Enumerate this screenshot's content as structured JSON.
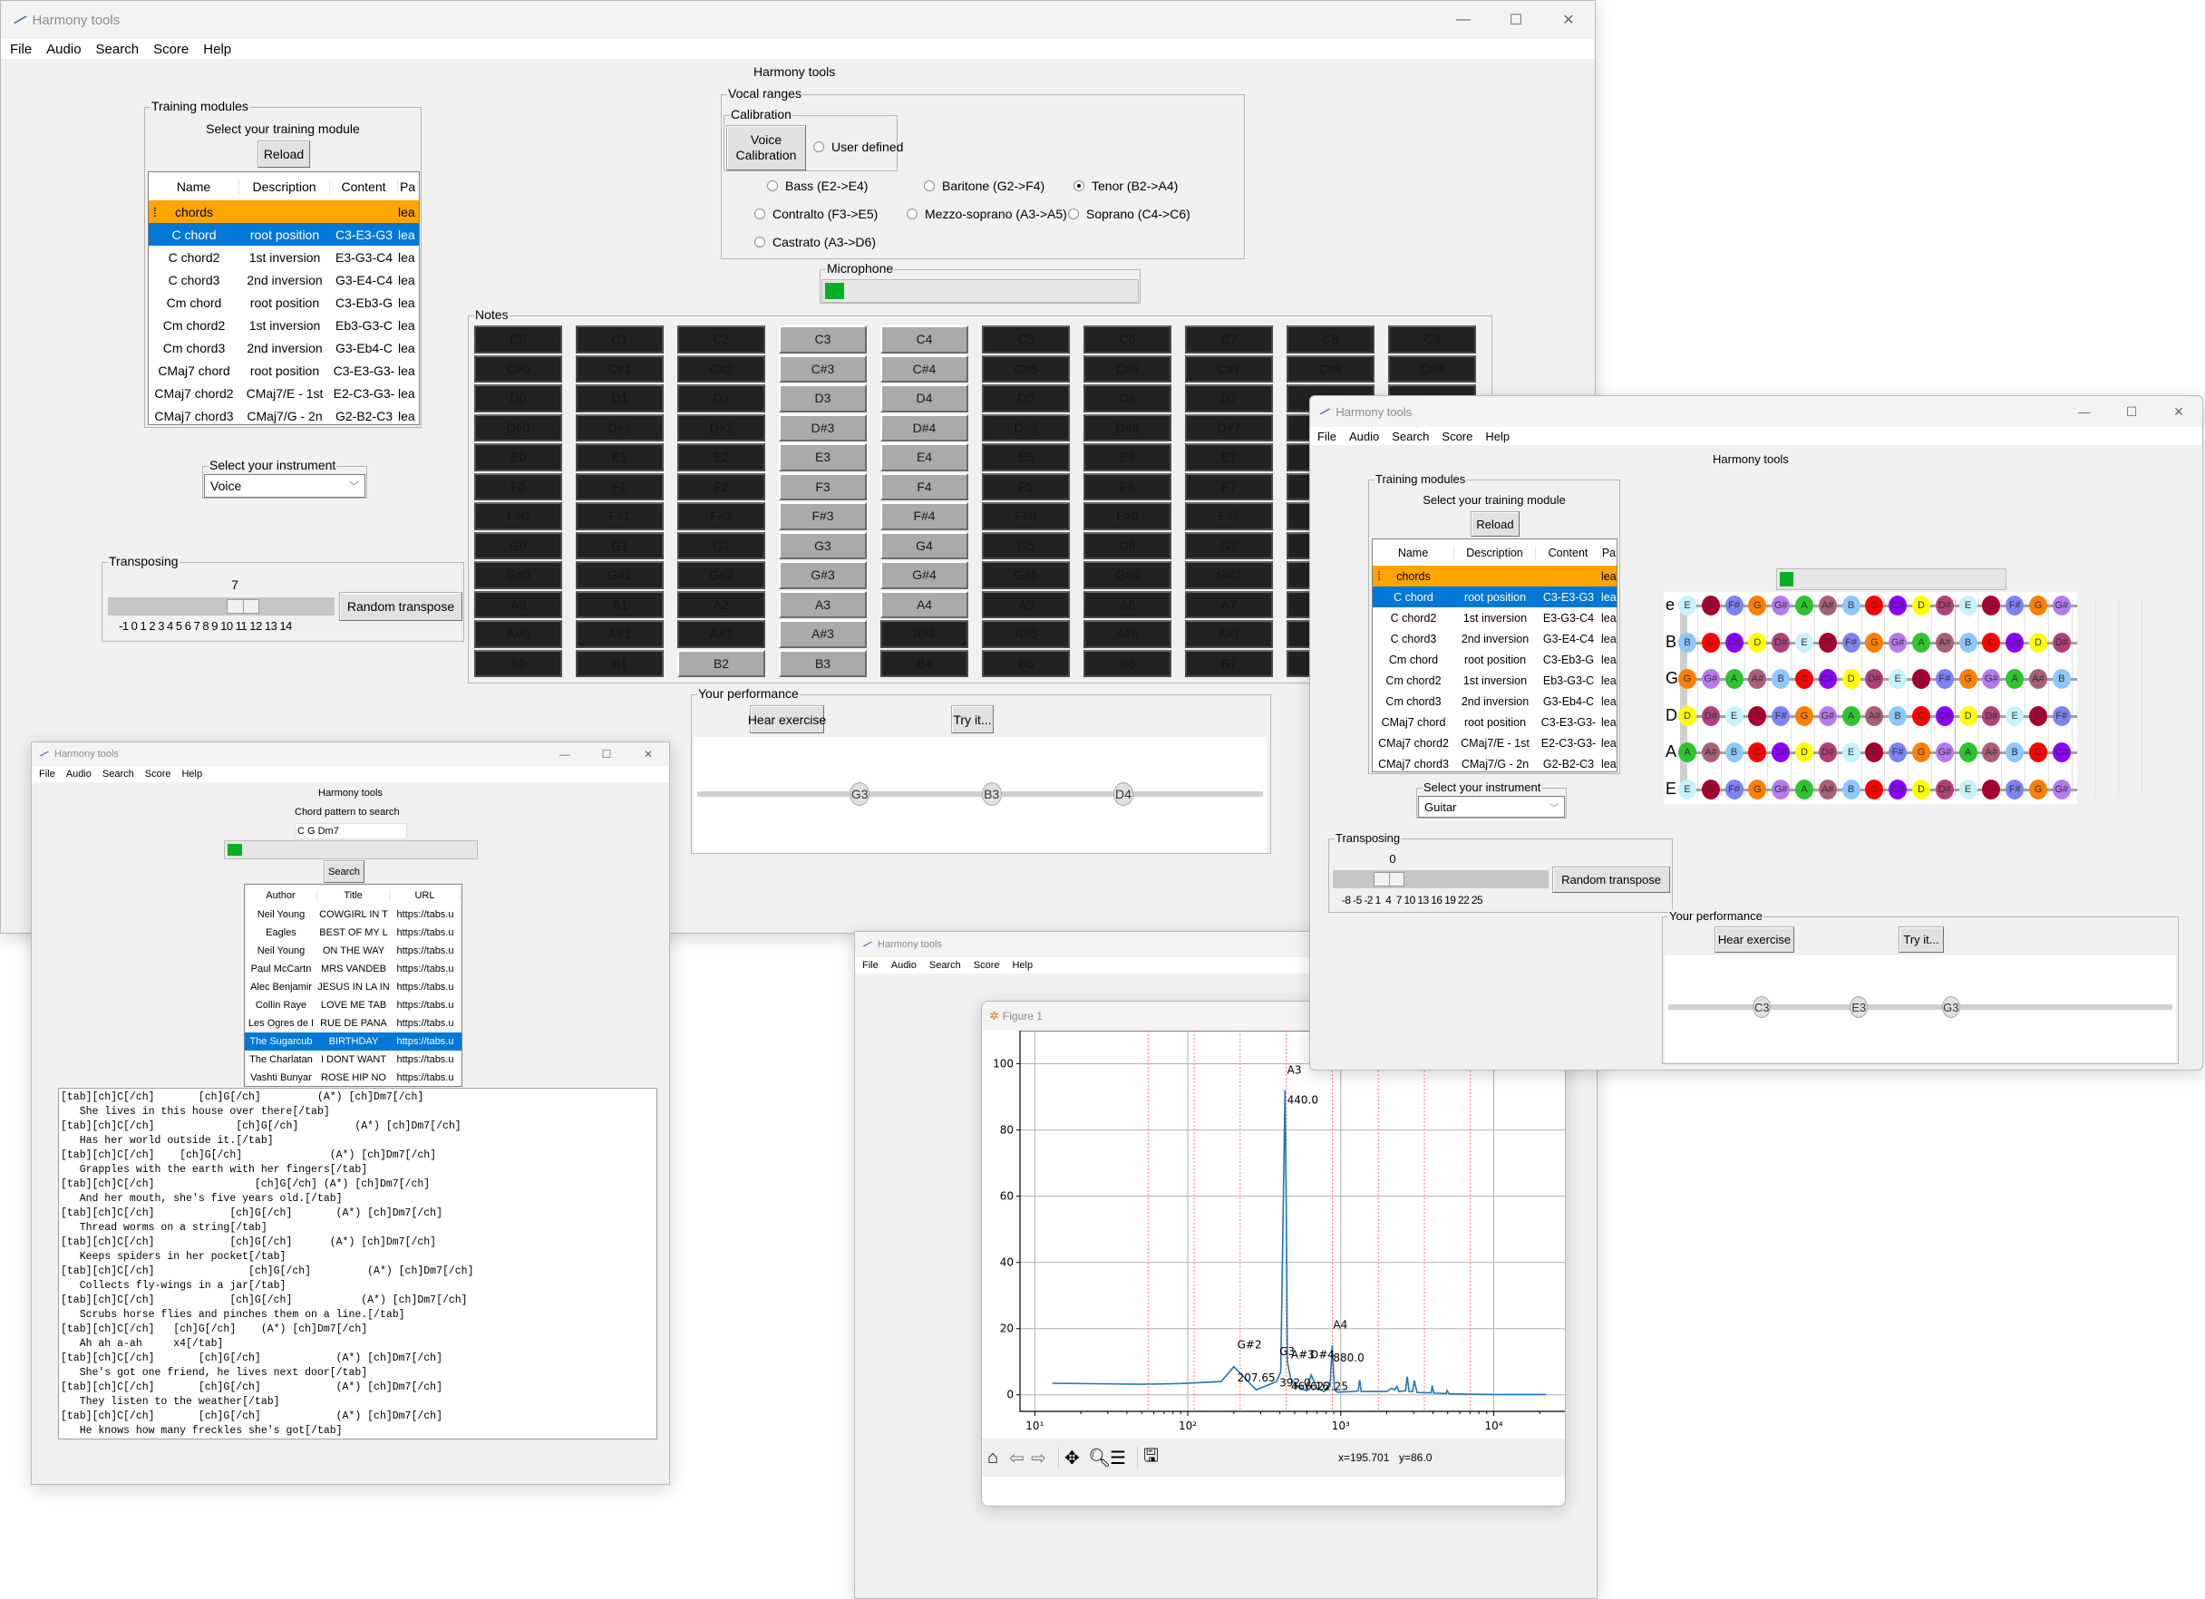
{
  "app_title": "Harmony tools",
  "menu": [
    "File",
    "Audio",
    "Search",
    "Score",
    "Help"
  ],
  "window_controls": {
    "minimize": "—",
    "maximize": "☐",
    "close": "✕"
  },
  "main_window": {
    "header": "Harmony tools",
    "training": {
      "frame_label": "Training modules",
      "prompt": "Select your training module",
      "reload_label": "Reload",
      "columns": [
        "Name",
        "Description",
        "Content",
        "Pa"
      ],
      "rows": [
        {
          "name": "chords",
          "description": "",
          "content": "",
          "path": "lea",
          "kind": "category",
          "marker": "⁞"
        },
        {
          "name": "C chord",
          "description": "root position",
          "content": "C3-E3-G3",
          "path": "lea",
          "kind": "selected"
        },
        {
          "name": "C chord2",
          "description": "1st inversion",
          "content": "E3-G3-C4",
          "path": "lea"
        },
        {
          "name": "C chord3",
          "description": "2nd inversion",
          "content": "G3-E4-C4",
          "path": "lea"
        },
        {
          "name": "Cm chord",
          "description": "root position",
          "content": "C3-Eb3-G",
          "path": "lea"
        },
        {
          "name": "Cm chord2",
          "description": "1st inversion",
          "content": "Eb3-G3-C",
          "path": "lea"
        },
        {
          "name": "Cm chord3",
          "description": "2nd inversion",
          "content": "G3-Eb4-C",
          "path": "lea"
        },
        {
          "name": "CMaj7 chord",
          "description": "root position",
          "content": "C3-E3-G3-",
          "path": "lea"
        },
        {
          "name": "CMaj7 chord2",
          "description": "CMaj7/E - 1st",
          "content": "E2-C3-G3-",
          "path": "lea"
        },
        {
          "name": "CMaj7 chord3",
          "description": "CMaj7/G - 2n",
          "content": "G2-B2-C3",
          "path": "lea"
        }
      ]
    },
    "instrument": {
      "label": "Select your instrument",
      "value": "Voice"
    },
    "transposing": {
      "label": "Transposing",
      "value": "7",
      "slider_fraction": 0.61,
      "scale": "-1 0 1 2 3 4 5 6 7 8 9 10 11 12 13 14",
      "button": "Random transpose"
    },
    "vocal": {
      "frame_label": "Vocal ranges",
      "calibration_label": "Calibration",
      "calibration_button": "Voice\nCalibration",
      "user_defined": "User defined",
      "options": [
        {
          "label": "Bass (E2->E4)",
          "selected": false
        },
        {
          "label": "Baritone (G2->F4)",
          "selected": false
        },
        {
          "label": "Tenor (B2->A4)",
          "selected": true
        },
        {
          "label": "Contralto (F3->E5)",
          "selected": false
        },
        {
          "label": "Mezzo-soprano (A3->A5)",
          "selected": false
        },
        {
          "label": "Soprano (C4->C6)",
          "selected": false
        },
        {
          "label": "Castrato (A3->D6)",
          "selected": false
        }
      ]
    },
    "microphone": {
      "label": "Microphone",
      "level": 0.06
    },
    "notes": {
      "label": "Notes",
      "octaves": [
        "0",
        "1",
        "2",
        "3",
        "4",
        "5",
        "6",
        "7",
        "8",
        "9"
      ],
      "names": [
        "C",
        "C#",
        "D",
        "D#",
        "E",
        "F",
        "F#",
        "G",
        "G#",
        "A",
        "A#",
        "B"
      ],
      "active": [
        "B2",
        "C3",
        "C#3",
        "D3",
        "D#3",
        "E3",
        "F3",
        "F#3",
        "G3",
        "G#3",
        "A3",
        "A#3",
        "B3",
        "C4",
        "C#4",
        "D4",
        "D#4",
        "E4",
        "F4",
        "F#4",
        "G4",
        "G#4",
        "A4"
      ],
      "visible_rows_in_last_cols": {
        "8": 2,
        "9": 2
      }
    },
    "performance": {
      "label": "Your performance",
      "hear": "Hear exercise",
      "try": "Try it...",
      "notes": [
        "G3",
        "B3",
        "D4"
      ]
    }
  },
  "guitar_window": {
    "header": "Harmony tools",
    "instrument": {
      "label": "Select your instrument",
      "value": "Guitar"
    },
    "transposing": {
      "label": "Transposing",
      "value": "0",
      "slider_fraction": 0.22,
      "scale": "-8 -5 -2 1  4  7 10 13 16 19 22 25",
      "button": "Random transpose"
    },
    "microphone_level": 0.06,
    "fretboard": {
      "strings": [
        "e",
        "B",
        "G",
        "D",
        "A",
        "E"
      ],
      "open_notes": [
        "E",
        "B",
        "G",
        "D",
        "A",
        "E"
      ],
      "chromatic": [
        "C",
        "C#",
        "D",
        "D#",
        "E",
        "F",
        "F#",
        "G",
        "G#",
        "A",
        "A#",
        "B"
      ],
      "frets_shown": 19,
      "colors": {
        "C": "#ff0000",
        "C#": "#8b00ff",
        "D": "#ffff00",
        "D#": "#b0407a",
        "E": "#c6f1ff",
        "F": "#a50030",
        "F#": "#7b83f5",
        "G": "#ff7f00",
        "G#": "#b57aef",
        "A": "#2ec42e",
        "A#": "#a86078",
        "B": "#8cc8ff"
      }
    },
    "performance": {
      "label": "Your performance",
      "hear": "Hear exercise",
      "try": "Try it...",
      "notes": [
        "C3",
        "E3",
        "G3"
      ]
    }
  },
  "search_window": {
    "header": "Harmony tools",
    "pattern_label": "Chord pattern to search",
    "pattern_value": "C G Dm7",
    "progress": 0.06,
    "search_button": "Search",
    "columns": [
      "Author",
      "Title",
      "URL"
    ],
    "rows": [
      {
        "author": "Neil Young",
        "title": "COWGIRL IN T",
        "url": "https://tabs.u"
      },
      {
        "author": "Eagles",
        "title": "BEST OF MY L",
        "url": "https://tabs.u"
      },
      {
        "author": "Neil Young",
        "title": "ON THE WAY",
        "url": "https://tabs.u"
      },
      {
        "author": "Paul McCartn",
        "title": "MRS VANDEB",
        "url": "https://tabs.u"
      },
      {
        "author": "Alec Benjamir",
        "title": "JESUS IN LA IN",
        "url": "https://tabs.u"
      },
      {
        "author": "Collin Raye",
        "title": "LOVE ME TAB",
        "url": "https://tabs.u"
      },
      {
        "author": "Les Ogres de I",
        "title": "RUE DE PANA",
        "url": "https://tabs.u"
      },
      {
        "author": "The Sugarcub",
        "title": "BIRTHDAY",
        "url": "https://tabs.u",
        "selected": true
      },
      {
        "author": "The Charlatan",
        "title": "I DONT WANT",
        "url": "https://tabs.u"
      },
      {
        "author": "Vashti Bunyar",
        "title": "ROSE HIP NO",
        "url": "https://tabs.u"
      }
    ],
    "tab_lines": [
      "[tab][ch]C[/ch]       [ch]G[/ch]         (A*) [ch]Dm7[/ch]",
      "   She lives in this house over there[/tab]",
      "[tab][ch]C[/ch]             [ch]G[/ch]         (A*) [ch]Dm7[/ch]",
      "   Has her world outside it.[/tab]",
      "[tab][ch]C[/ch]    [ch]G[/ch]              (A*) [ch]Dm7[/ch]",
      "   Grapples with the earth with her fingers[/tab]",
      "[tab][ch]C[/ch]                [ch]G[/ch] (A*) [ch]Dm7[/ch]",
      "   And her mouth, she's five years old.[/tab]",
      "[tab][ch]C[/ch]            [ch]G[/ch]       (A*) [ch]Dm7[/ch]",
      "   Thread worms on a string[/tab]",
      "[tab][ch]C[/ch]            [ch]G[/ch]      (A*) [ch]Dm7[/ch]",
      "   Keeps spiders in her pocket[/tab]",
      "[tab][ch]C[/ch]               [ch]G[/ch]         (A*) [ch]Dm7[/ch]",
      "   Collects fly-wings in a jar[/tab]",
      "[tab][ch]C[/ch]            [ch]G[/ch]           (A*) [ch]Dm7[/ch]",
      "   Scrubs horse flies and pinches them on a line.[/tab]",
      "[tab][ch]C[/ch]   [ch]G[/ch]    (A*) [ch]Dm7[/ch]",
      "   Ah ah a-ah     x4[/tab]",
      "[tab][ch]C[/ch]       [ch]G[/ch]            (A*) [ch]Dm7[/ch]",
      "   She's got one friend, he lives next door[/tab]",
      "[tab][ch]C[/ch]       [ch]G[/ch]            (A*) [ch]Dm7[/ch]",
      "   They listen to the weather[/tab]",
      "[tab][ch]C[/ch]       [ch]G[/ch]            (A*) [ch]Dm7[/ch]",
      "   He knows how many freckles she's got[/tab]"
    ]
  },
  "spectrum_window": {
    "header": "Harmony tools",
    "figure_title": "Figure 1",
    "status": {
      "x": "x=195.701",
      "y": "y=86.0"
    },
    "toolbar": [
      "home-icon",
      "back-icon",
      "forward-icon",
      "pan-icon",
      "zoom-icon",
      "configure-icon",
      "save-icon"
    ]
  },
  "chart_data": {
    "type": "line",
    "title": "",
    "xlabel": "",
    "ylabel": "",
    "xscale": "log",
    "xlim": [
      8,
      30000
    ],
    "ylim": [
      -5,
      110
    ],
    "xticks": [
      10,
      100,
      1000,
      10000
    ],
    "xtick_labels": [
      "10¹",
      "10²",
      "10³",
      "10⁴"
    ],
    "yticks": [
      0,
      20,
      40,
      60,
      80,
      100
    ],
    "grid": true,
    "reference_lines_hz": [
      55,
      110,
      220,
      440,
      880,
      1760,
      3520,
      7040
    ],
    "series": [
      {
        "name": "spectrum",
        "color": "#1f77b4",
        "x": [
          13,
          50,
          90,
          165,
          200,
          280,
          380,
          405,
          432,
          440,
          448,
          470,
          520,
          600,
          640,
          700,
          780,
          850,
          880,
          910,
          950,
          1200,
          1300,
          1330,
          1360,
          1500,
          2000,
          2150,
          2250,
          2330,
          2400,
          2650,
          2720,
          2800,
          2950,
          3030,
          3150,
          3900,
          3960,
          4050,
          4900,
          4950,
          5100,
          7000,
          10000,
          15000,
          22000
        ],
        "y": [
          3.5,
          3.2,
          3.4,
          4,
          8.5,
          1.5,
          4,
          7,
          92,
          60,
          10,
          5,
          2.5,
          1.2,
          6,
          2,
          1,
          2.5,
          15,
          1.5,
          0.8,
          1,
          1.2,
          4.5,
          1,
          1,
          1,
          2,
          1.5,
          2.5,
          1,
          1.2,
          5.5,
          1,
          1,
          4.3,
          0.7,
          0.6,
          2.8,
          0.5,
          0.4,
          1.3,
          0.3,
          0.2,
          0.1,
          0.1,
          0.1
        ]
      }
    ],
    "annotations": [
      {
        "text": "A3",
        "x": 440,
        "y": 97
      },
      {
        "text": "440.0",
        "x": 440,
        "y": 88
      },
      {
        "text": "G#2",
        "x": 207.65,
        "y": 14
      },
      {
        "text": "207.65",
        "x": 207.65,
        "y": 4
      },
      {
        "text": "G3",
        "x": 392.0,
        "y": 12
      },
      {
        "text": "392.0",
        "x": 392.0,
        "y": 2.5
      },
      {
        "text": "A#3",
        "x": 466.16,
        "y": 11
      },
      {
        "text": "466.16",
        "x": 466.16,
        "y": 1.5
      },
      {
        "text": "D#4",
        "x": 622.25,
        "y": 11
      },
      {
        "text": "622.25",
        "x": 622.25,
        "y": 1.5
      },
      {
        "text": "A4",
        "x": 880,
        "y": 20
      },
      {
        "text": "880.0",
        "x": 880,
        "y": 10
      }
    ]
  }
}
